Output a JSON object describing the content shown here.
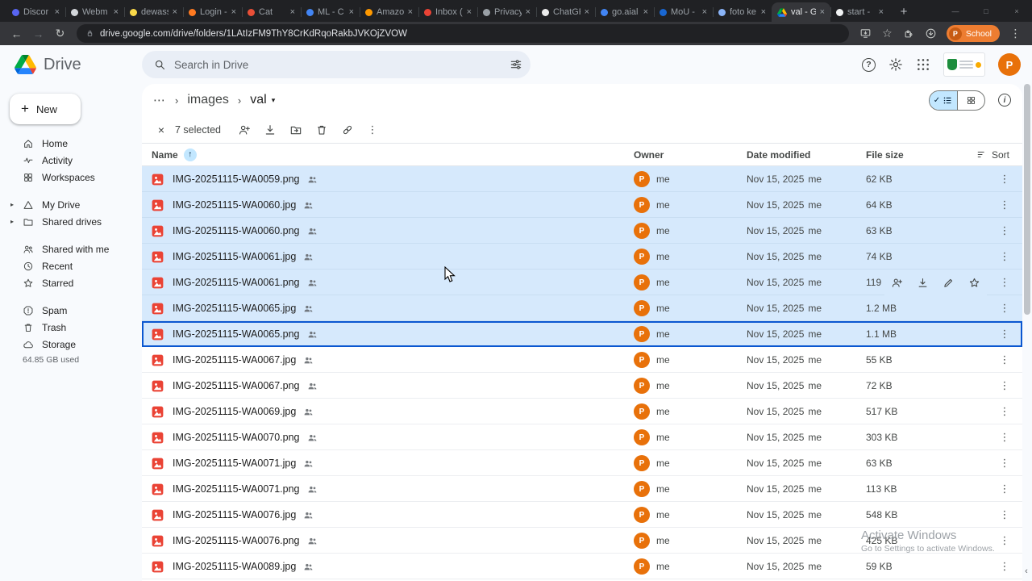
{
  "colors": {
    "accent": "#0b57d0",
    "selection": "#d6e9fc",
    "file_red": "#ea4335",
    "avatar_orange": "#e8710a"
  },
  "glyphs": {
    "close": "×",
    "plus": "+",
    "minimize": "—",
    "maximize": "□",
    "back": "←",
    "forward": "→",
    "reload": "↻",
    "bookmark": "☆",
    "more": "⋮",
    "chevron_right": "›",
    "caret_down": "▾",
    "caret_right": "▸",
    "check": "✓",
    "sort_asc": "↑",
    "help": "?",
    "info": "i",
    "scroll_left": "‹"
  },
  "browser": {
    "tabs": [
      {
        "label": "Discor",
        "color": "#5865f2"
      },
      {
        "label": "Webm",
        "color": "#d3d6da"
      },
      {
        "label": "dewass",
        "color": "#f9d849"
      },
      {
        "label": "Login -",
        "color": "#ff7a21"
      },
      {
        "label": "Cat",
        "color": "#e94f37"
      },
      {
        "label": "ML - C",
        "color": "#4285f4"
      },
      {
        "label": "Amazo",
        "color": "#ff9900"
      },
      {
        "label": "Inbox (",
        "color": "#ea4335"
      },
      {
        "label": "Privacy",
        "color": "#9aa0a6"
      },
      {
        "label": "ChatGF",
        "color": "#ececec"
      },
      {
        "label": "go.aial",
        "color": "#4285f4"
      },
      {
        "label": "MoU -",
        "color": "#1967d2"
      },
      {
        "label": "foto ke",
        "color": "#8ab4f8"
      },
      {
        "label": "val - G",
        "active": true,
        "drive_icon": true
      },
      {
        "label": "start -",
        "color": "#f1f3f4"
      }
    ],
    "url": "drive.google.com/drive/folders/1LAtIzFM9ThY8CrKdRqoRakbJVKOjZVOW",
    "profile": {
      "name": "School",
      "initial": "P"
    }
  },
  "drive": {
    "app_name": "Drive",
    "search": {
      "placeholder": "Search in Drive"
    },
    "sidebar": {
      "new_label": "New",
      "groups": [
        [
          "Home",
          "Activity",
          "Workspaces"
        ],
        [
          "My Drive",
          "Shared drives"
        ],
        [
          "Shared with me",
          "Recent",
          "Starred"
        ],
        [
          "Spam",
          "Trash",
          "Storage"
        ]
      ],
      "storage_used": "64.85 GB used"
    },
    "breadcrumb": {
      "collapsed": "⋯",
      "parent": "images",
      "current": "val"
    },
    "selection_toolbar": {
      "count_label": "7 selected"
    },
    "table": {
      "headers": {
        "name": "Name",
        "owner": "Owner",
        "modified": "Date modified",
        "size": "File size",
        "sort": "Sort"
      },
      "owner_initial": "P",
      "rows": [
        {
          "name": "IMG-20251115-WA0059.png",
          "owner": "me",
          "modified": "Nov 15, 2025",
          "modified_by": "me",
          "size": "62 KB",
          "selected": true
        },
        {
          "name": "IMG-20251115-WA0060.jpg",
          "owner": "me",
          "modified": "Nov 15, 2025",
          "modified_by": "me",
          "size": "64 KB",
          "selected": true
        },
        {
          "name": "IMG-20251115-WA0060.png",
          "owner": "me",
          "modified": "Nov 15, 2025",
          "modified_by": "me",
          "size": "63 KB",
          "selected": true
        },
        {
          "name": "IMG-20251115-WA0061.jpg",
          "owner": "me",
          "modified": "Nov 15, 2025",
          "modified_by": "me",
          "size": "74 KB",
          "selected": true
        },
        {
          "name": "IMG-20251115-WA0061.png",
          "owner": "me",
          "modified": "Nov 15, 2025",
          "modified_by": "me",
          "size": "119 KB",
          "selected": true,
          "hovered": true
        },
        {
          "name": "IMG-20251115-WA0065.jpg",
          "owner": "me",
          "modified": "Nov 15, 2025",
          "modified_by": "me",
          "size": "1.2 MB",
          "selected": true
        },
        {
          "name": "IMG-20251115-WA0065.png",
          "owner": "me",
          "modified": "Nov 15, 2025",
          "modified_by": "me",
          "size": "1.1 MB",
          "selected": true,
          "focused": true
        },
        {
          "name": "IMG-20251115-WA0067.jpg",
          "owner": "me",
          "modified": "Nov 15, 2025",
          "modified_by": "me",
          "size": "55 KB"
        },
        {
          "name": "IMG-20251115-WA0067.png",
          "owner": "me",
          "modified": "Nov 15, 2025",
          "modified_by": "me",
          "size": "72 KB"
        },
        {
          "name": "IMG-20251115-WA0069.jpg",
          "owner": "me",
          "modified": "Nov 15, 2025",
          "modified_by": "me",
          "size": "517 KB"
        },
        {
          "name": "IMG-20251115-WA0070.png",
          "owner": "me",
          "modified": "Nov 15, 2025",
          "modified_by": "me",
          "size": "303 KB"
        },
        {
          "name": "IMG-20251115-WA0071.jpg",
          "owner": "me",
          "modified": "Nov 15, 2025",
          "modified_by": "me",
          "size": "63 KB"
        },
        {
          "name": "IMG-20251115-WA0071.png",
          "owner": "me",
          "modified": "Nov 15, 2025",
          "modified_by": "me",
          "size": "113 KB"
        },
        {
          "name": "IMG-20251115-WA0076.jpg",
          "owner": "me",
          "modified": "Nov 15, 2025",
          "modified_by": "me",
          "size": "548 KB"
        },
        {
          "name": "IMG-20251115-WA0076.png",
          "owner": "me",
          "modified": "Nov 15, 2025",
          "modified_by": "me",
          "size": "425 KB"
        },
        {
          "name": "IMG-20251115-WA0089.jpg",
          "owner": "me",
          "modified": "Nov 15, 2025",
          "modified_by": "me",
          "size": "59 KB"
        }
      ]
    }
  },
  "watermark": {
    "line1": "Activate Windows",
    "line2": "Go to Settings to activate Windows."
  }
}
